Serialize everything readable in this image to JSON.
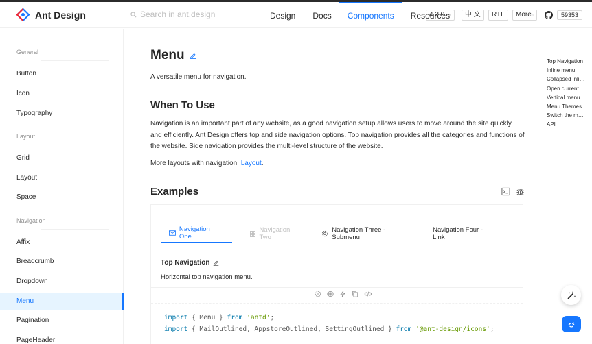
{
  "header": {
    "logo_text": "Ant Design",
    "search_placeholder": "Search in ant.design",
    "nav": [
      "Design",
      "Docs",
      "Components",
      "Resources"
    ],
    "version": "4.2.0",
    "lang": "中 文",
    "rtl": "RTL",
    "more": "More",
    "stars": "59353"
  },
  "sidebar": {
    "groups": [
      {
        "title": "General",
        "items": [
          "Button",
          "Icon",
          "Typography"
        ]
      },
      {
        "title": "Layout",
        "items": [
          "Grid",
          "Layout",
          "Space"
        ]
      },
      {
        "title": "Navigation",
        "items": [
          "Affix",
          "Breadcrumb",
          "Dropdown",
          "Menu",
          "Pagination",
          "PageHeader"
        ]
      }
    ]
  },
  "main": {
    "title": "Menu",
    "subtitle": "A versatile menu for navigation.",
    "when_title": "When To Use",
    "when_para": "Navigation is an important part of any website, as a good navigation setup allows users to move around the site quickly and efficiently. Ant Design offers top and side navigation options. Top navigation provides all the categories and functions of the website. Side navigation provides the multi-level structure of the website.",
    "more_layouts_prefix": "More layouts with navigation: ",
    "more_layouts_link": "Layout",
    "more_layouts_suffix": ".",
    "examples_title": "Examples"
  },
  "example": {
    "tabs": [
      "Navigation One",
      "Navigation Two",
      "Navigation Three - Submenu",
      "Navigation Four - Link"
    ],
    "code_title": "Top Navigation",
    "code_desc": "Horizontal top navigation menu.",
    "code_line1": {
      "kw": "import",
      "open": " { Menu } ",
      "from": "from",
      "str": "'antd'",
      "end": ";"
    },
    "code_line2": {
      "kw": "import",
      "open": " { MailOutlined, AppstoreOutlined, SettingOutlined } ",
      "from": "from",
      "str": "'@ant-design/icons'",
      "end": ";"
    }
  },
  "anchors": [
    "Top Navigation",
    "Inline menu",
    "Collapsed inline menu",
    "Open current submenu only",
    "Vertical menu",
    "Menu Themes",
    "Switch the menu type",
    "API"
  ],
  "colors": {
    "primary": "#1677ff",
    "active_bg": "#e6f4ff",
    "border": "#f0f0f0"
  }
}
